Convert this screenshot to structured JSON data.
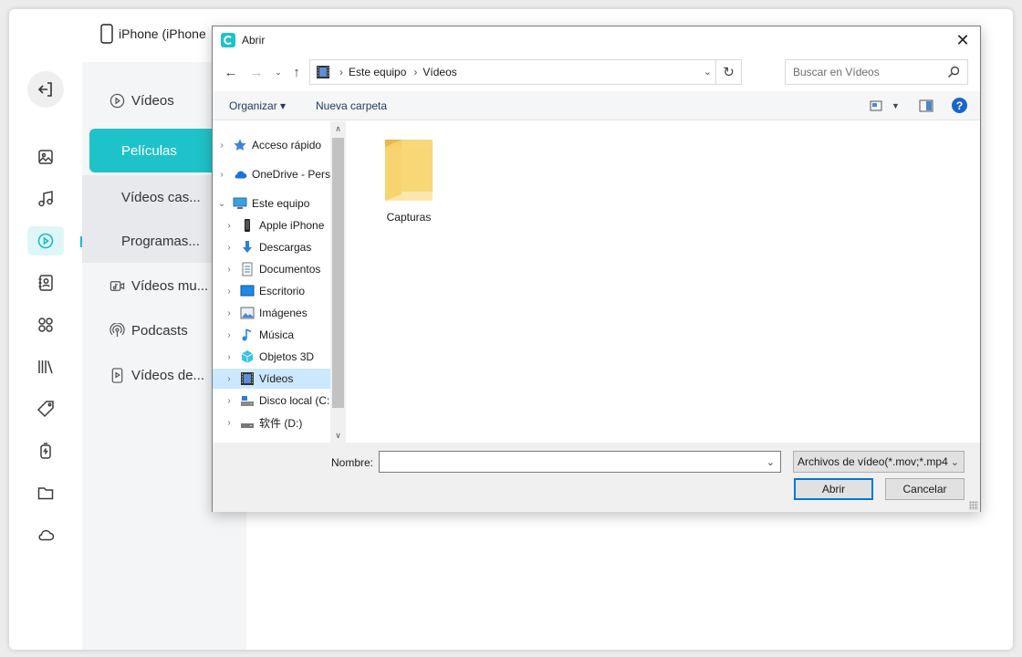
{
  "app": {
    "device_name": "iPhone  (iPhone",
    "colors": {
      "accent": "#1ec3c9",
      "active_icon_bg": "#dff6f7"
    },
    "rail_icons": [
      "back-icon",
      "photos-icon",
      "music-icon",
      "videos-icon",
      "contacts-icon",
      "apps-icon",
      "books-icon",
      "tags-icon",
      "voice-memo-icon",
      "files-icon",
      "cloud-icon"
    ],
    "sidebar": {
      "items": [
        {
          "label": "Vídeos",
          "icon": "play-circle-icon"
        },
        {
          "label": "Películas",
          "active": true
        },
        {
          "label": "Vídeos cas..."
        },
        {
          "label": "Programas..."
        },
        {
          "label": "Vídeos mu...",
          "icon": "music-video-icon"
        },
        {
          "label": "Podcasts",
          "icon": "podcast-icon"
        },
        {
          "label": "Vídeos de...",
          "icon": "phone-video-icon"
        }
      ]
    }
  },
  "dialog": {
    "title": "Abrir",
    "breadcrumb": [
      "Este equipo",
      "Vídeos"
    ],
    "search_placeholder": "Buscar en Vídeos",
    "toolbar": {
      "organize": "Organizar",
      "new_folder": "Nueva carpeta"
    },
    "tree": [
      {
        "label": "Acceso rápido",
        "icon": "star-icon",
        "level": 0,
        "chev": ">"
      },
      {
        "label": "OneDrive - Pers",
        "icon": "cloud-icon",
        "level": 0,
        "chev": ">"
      },
      {
        "label": "Este equipo",
        "icon": "computer-icon",
        "level": 0,
        "chev": "v"
      },
      {
        "label": "Apple iPhone",
        "icon": "iphone-icon",
        "level": 1,
        "chev": ">"
      },
      {
        "label": "Descargas",
        "icon": "download-icon",
        "level": 1,
        "chev": ">"
      },
      {
        "label": "Documentos",
        "icon": "document-icon",
        "level": 1,
        "chev": ">"
      },
      {
        "label": "Escritorio",
        "icon": "desktop-icon",
        "level": 1,
        "chev": ">"
      },
      {
        "label": "Imágenes",
        "icon": "pictures-icon",
        "level": 1,
        "chev": ">"
      },
      {
        "label": "Música",
        "icon": "music-note-icon",
        "level": 1,
        "chev": ">"
      },
      {
        "label": "Objetos 3D",
        "icon": "cube-icon",
        "level": 1,
        "chev": ">"
      },
      {
        "label": "Vídeos",
        "icon": "film-icon",
        "level": 1,
        "chev": ">",
        "selected": true
      },
      {
        "label": "Disco local (C:",
        "icon": "drive-icon",
        "level": 1,
        "chev": ">"
      },
      {
        "label": "软件 (D:)",
        "icon": "drive-icon",
        "level": 1,
        "chev": ">"
      }
    ],
    "files": [
      {
        "name": "Capturas",
        "type": "folder"
      }
    ],
    "bottom": {
      "name_label": "Nombre:",
      "name_value": "",
      "filter": "Archivos de vídeo(*.mov;*.mp4",
      "open": "Abrir",
      "cancel": "Cancelar"
    }
  }
}
